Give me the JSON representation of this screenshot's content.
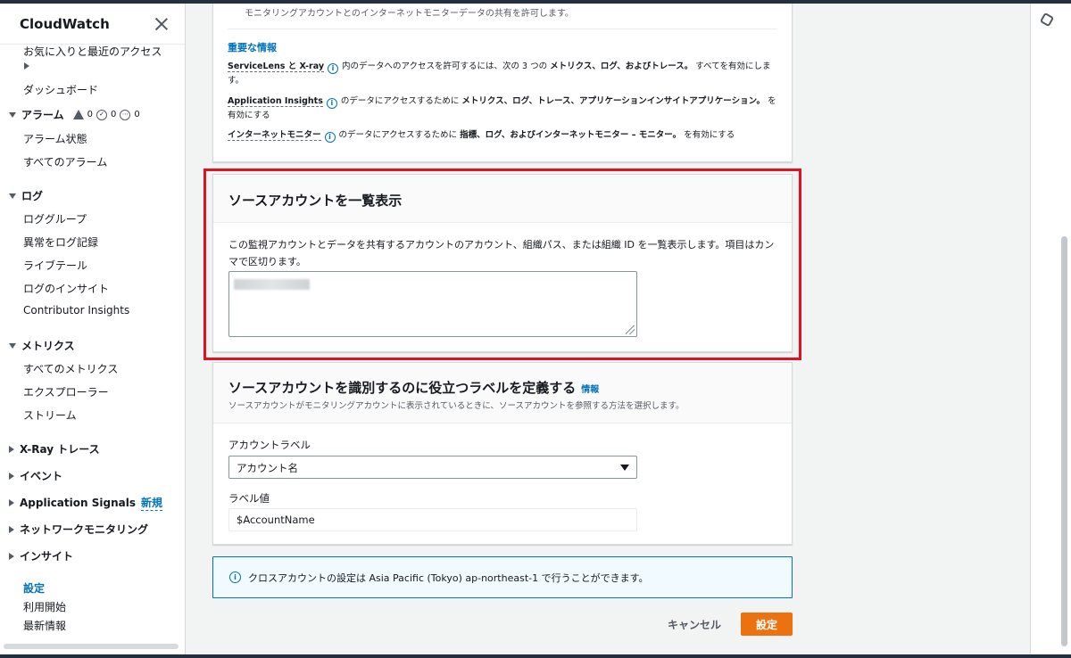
{
  "sidebar": {
    "title": "CloudWatch",
    "favorites": "お気に入りと最近のアクセス",
    "dashboard": "ダッシュボード",
    "alarms": {
      "label": "アラーム",
      "counts": [
        "0",
        "0",
        "0"
      ],
      "items": [
        "アラーム状態",
        "すべてのアラーム"
      ]
    },
    "logs": {
      "label": "ログ",
      "items": [
        "ロググループ",
        "異常をログ記録",
        "ライブテール",
        "ログのインサイト",
        "Contributor Insights"
      ]
    },
    "metrics": {
      "label": "メトリクス",
      "items": [
        "すべてのメトリクス",
        "エクスプローラー",
        "ストリーム"
      ]
    },
    "collapsed": [
      "X-Ray トレース",
      "イベント",
      "Application Signals",
      "ネットワークモニタリング",
      "インサイト"
    ],
    "new_badge": "新規",
    "footer": [
      "設定",
      "利用開始",
      "最新情報"
    ]
  },
  "top_panel": {
    "line1": "モニタリングアカウントとのインターネットモニターデータの共有を許可します。",
    "heading": "重要な情報",
    "rows": [
      {
        "term": "ServiceLens と X-ray",
        "pre": "内のデータへのアクセスを許可するには、次の 3 つの ",
        "bold": "メトリクス、ログ、およびトレース。",
        "post": " すべてを有効にします。"
      },
      {
        "term": "Application Insights",
        "pre": "のデータにアクセスするために ",
        "bold": "メトリクス、ログ、トレース、アプリケーションインサイトアプリケーション。",
        "post": " を有効にする"
      },
      {
        "term": "インターネットモニター",
        "pre": "のデータにアクセスするために ",
        "bold": "指標、ログ、およびインターネットモニター – モニター。",
        "post": " を有効にする"
      }
    ]
  },
  "source_panel": {
    "title": "ソースアカウントを一覧表示",
    "description": "この監視アカウントとデータを共有するアカウントのアカウント、組織パス、または組織 ID を一覧表示します。項目はカンマで区切ります。"
  },
  "label_panel": {
    "title": "ソースアカウントを識別するのに役立つラベルを定義する",
    "info": "情報",
    "description": "ソースアカウントがモニタリングアカウントに表示されているときに、ソースアカウントを参照する方法を選択します。",
    "account_label": "アカウントラベル",
    "account_label_value": "アカウント名",
    "label_value_title": "ラベル値",
    "label_value": "$AccountName"
  },
  "alert": {
    "text": "クロスアカウントの設定は Asia Pacific (Tokyo) ap-northeast-1 で行うことができます。"
  },
  "actions": {
    "cancel": "キャンセル",
    "save": "設定"
  },
  "colors": {
    "accent": "#0073bb",
    "primary_button": "#ec7211",
    "highlight": "#e0121f"
  }
}
